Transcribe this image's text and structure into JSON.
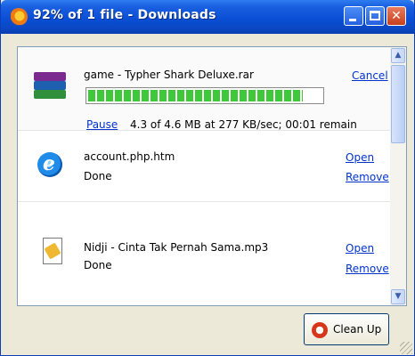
{
  "window": {
    "title": "92% of 1 file - Downloads"
  },
  "downloads": [
    {
      "filename": "game - Typher Shark Deluxe.rar",
      "icon": "winrar-icon",
      "progress": 0.92,
      "action": "Cancel",
      "pause_label": "Pause",
      "transfer": "4.3 of 4.6 MB at 277 KB/sec; 00:01 remain"
    },
    {
      "filename": "account.php.htm",
      "icon": "internet-explorer-icon",
      "status": "Done",
      "open_label": "Open",
      "remove_label": "Remove"
    },
    {
      "filename": "Nidji - Cinta Tak Pernah Sama.mp3",
      "icon": "mp3-file-icon",
      "status": "Done",
      "open_label": "Open",
      "remove_label": "Remove"
    }
  ],
  "footer": {
    "cleanup_label": "Clean Up"
  }
}
